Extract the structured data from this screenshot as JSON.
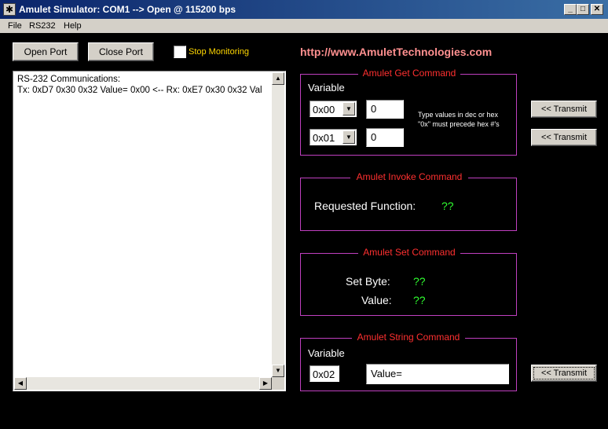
{
  "window": {
    "title": "Amulet Simulator: COM1 --> Open @ 115200 bps",
    "icon": "asterisk-icon"
  },
  "menu": {
    "items": [
      "File",
      "RS232",
      "Help"
    ]
  },
  "toolbar": {
    "open_port": "Open Port",
    "close_port": "Close Port",
    "stop_monitoring": "Stop Monitoring",
    "stop_monitoring_checked": false
  },
  "url": "http://www.AmuletTechnologies.com",
  "log": {
    "lines": [
      "RS-232 Communications:",
      "Tx: 0xD7 0x30 0x32 Value= 0x00 <-- Rx: 0xE7 0x30 0x32 Val"
    ]
  },
  "get_command": {
    "title": "Amulet Get Command",
    "variable_label": "Variable",
    "rows": [
      {
        "combo": "0x00",
        "value": "0"
      },
      {
        "combo": "0x01",
        "value": "0"
      }
    ],
    "hint_line1": "Type values in dec or hex",
    "hint_line2": "\"0x\" must precede hex #'s",
    "transmit1": "<< Transmit",
    "transmit2": "<< Transmit"
  },
  "invoke_command": {
    "title": "Amulet Invoke Command",
    "label": "Requested Function:",
    "value": "??"
  },
  "set_command": {
    "title": "Amulet Set Command",
    "byte_label": "Set Byte:",
    "byte_value": "??",
    "value_label": "Value:",
    "value_value": "??"
  },
  "string_command": {
    "title": "Amulet String Command",
    "variable_label": "Variable",
    "combo": "0x02",
    "value": "Value=",
    "transmit": "<< Transmit"
  },
  "colors": {
    "background": "#000000",
    "group_border": "#c040c0",
    "group_title": "#ff3030",
    "status_value": "#30ff30",
    "url": "#ff9090",
    "stop_monitoring": "#ffd700"
  }
}
